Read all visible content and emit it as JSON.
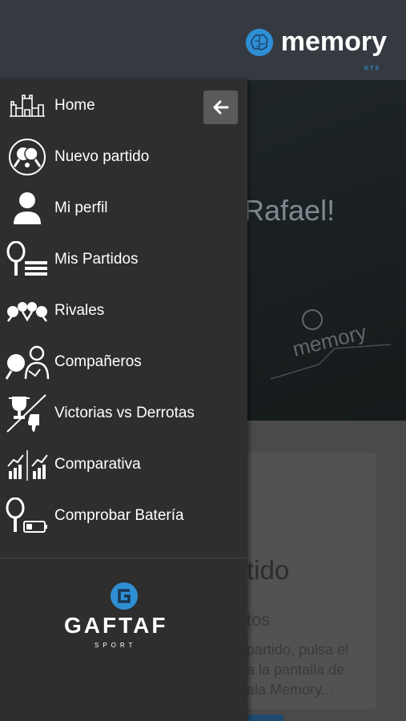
{
  "app": {
    "brand_name": "memory",
    "brand_sub": "GTS",
    "accent_color": "#2f8fd4"
  },
  "background": {
    "greeting_fragment": "Rafael!",
    "card_title_fragment": "tido",
    "card_subtitle_fragment": "tos",
    "card_body_lines": [
      "partido, pulsa el",
      "a la pantalla de",
      "ala Memory..."
    ]
  },
  "drawer": {
    "back_icon": "arrow-left-icon",
    "items": [
      {
        "label": "Home",
        "icon": "home-icon"
      },
      {
        "label": "Nuevo partido",
        "icon": "new-match-icon"
      },
      {
        "label": "Mi perfil",
        "icon": "user-profile-icon"
      },
      {
        "label": "Mis Partidos",
        "icon": "my-matches-icon"
      },
      {
        "label": "Rivales",
        "icon": "rivals-icon"
      },
      {
        "label": "Compañeros",
        "icon": "partners-icon"
      },
      {
        "label": "Victorias vs Derrotas",
        "icon": "wins-vs-losses-icon"
      },
      {
        "label": "Comparativa",
        "icon": "comparison-icon"
      },
      {
        "label": "Comprobar Batería",
        "icon": "battery-icon"
      }
    ],
    "footer": {
      "logo_text": "GAFTAF",
      "logo_sub": "SPORT"
    }
  }
}
